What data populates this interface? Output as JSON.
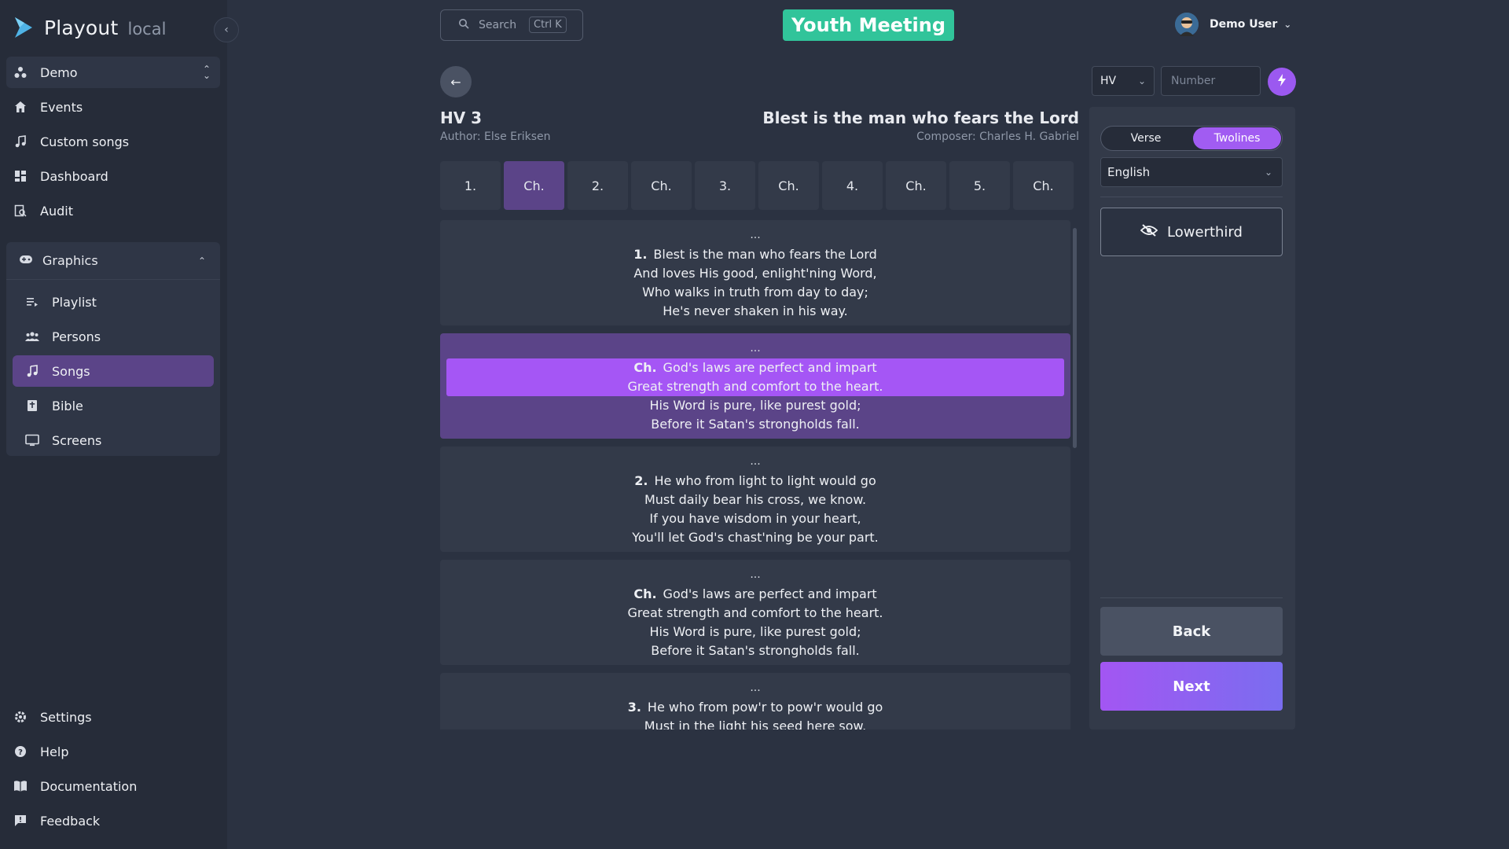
{
  "brand": {
    "name": "Playout",
    "env": "local"
  },
  "sidebar": {
    "workspace": "Demo",
    "top_items": [
      {
        "label": "Events",
        "icon": "home-icon"
      },
      {
        "label": "Custom songs",
        "icon": "music-note-icon"
      },
      {
        "label": "Dashboard",
        "icon": "dashboard-icon"
      },
      {
        "label": "Audit",
        "icon": "audit-icon"
      }
    ],
    "graphics": {
      "label": "Graphics",
      "items": [
        {
          "label": "Playlist",
          "icon": "playlist-icon"
        },
        {
          "label": "Persons",
          "icon": "people-icon"
        },
        {
          "label": "Songs",
          "icon": "music-note-icon"
        },
        {
          "label": "Bible",
          "icon": "bible-icon"
        },
        {
          "label": "Screens",
          "icon": "monitor-icon"
        }
      ]
    },
    "bottom_items": [
      {
        "label": "Settings",
        "icon": "gear-icon"
      },
      {
        "label": "Help",
        "icon": "help-icon"
      },
      {
        "label": "Documentation",
        "icon": "book-icon"
      },
      {
        "label": "Feedback",
        "icon": "feedback-icon"
      }
    ]
  },
  "header": {
    "search_placeholder": "Search",
    "search_shortcut": "Ctrl K",
    "event_title": "Youth Meeting",
    "user_name": "Demo User"
  },
  "song": {
    "number": "HV 3",
    "author": "Author: Else Eriksen",
    "title": "Blest is the man who fears the Lord",
    "composer": "Composer: Charles H. Gabriel",
    "tabs": [
      "1.",
      "Ch.",
      "2.",
      "Ch.",
      "3.",
      "Ch.",
      "4.",
      "Ch.",
      "5.",
      "Ch."
    ],
    "active_tab": 1,
    "verses": [
      {
        "label": "1.",
        "lines": [
          "Blest is the man who fears the Lord",
          "And loves His good, enlight'ning Word,",
          "Who walks in truth from day to day;",
          "He's never shaken in his way."
        ]
      },
      {
        "label": "Ch.",
        "lines": [
          "God's laws are perfect and impart",
          "Great strength and comfort to the heart.",
          "His Word is pure, like purest gold;",
          "Before it Satan's strongholds fall."
        ]
      },
      {
        "label": "2.",
        "lines": [
          "He who from light to light would go",
          "Must daily bear his cross, we know.",
          "If you have wisdom in your heart,",
          "You'll let God's chast'ning be your part."
        ]
      },
      {
        "label": "Ch.",
        "lines": [
          "God's laws are perfect and impart",
          "Great strength and comfort to the heart.",
          "His Word is pure, like purest gold;",
          "Before it Satan's strongholds fall."
        ]
      },
      {
        "label": "3.",
        "lines": [
          "He who from pow'r to pow'r would go",
          "Must in the light his seed here sow."
        ]
      }
    ],
    "dots": "..."
  },
  "controls": {
    "book_select": "HV",
    "number_placeholder": "Number",
    "mode_options": [
      "Verse",
      "Twolines"
    ],
    "mode_selected": "Twolines",
    "language": "English",
    "lowerthird_label": "Lowerthird",
    "back_label": "Back",
    "next_label": "Next"
  },
  "colors": {
    "accent": "#a356f2",
    "active": "#5b4488",
    "event_badge": "#31c49a"
  }
}
